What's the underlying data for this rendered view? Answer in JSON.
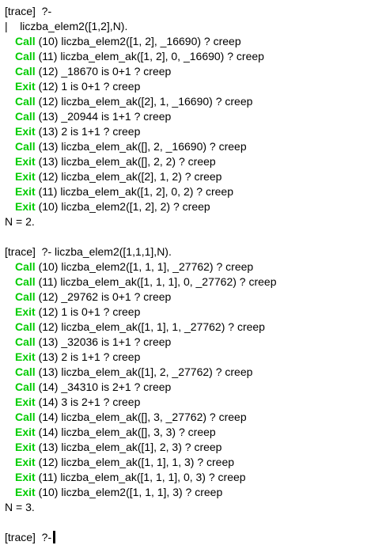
{
  "colors": {
    "background": "#ffffff",
    "text": "#000000",
    "call": "#00cc00",
    "exit": "#00cc00"
  },
  "lines": [
    {
      "type": "prompt",
      "text": "[trace]  ?-"
    },
    {
      "type": "text",
      "text": "|    liczba_elem2([1,2],N)."
    },
    {
      "type": "trace",
      "port": "Call",
      "text": " (10) liczba_elem2([1, 2], _16690) ? creep"
    },
    {
      "type": "trace",
      "port": "Call",
      "text": " (11) liczba_elem_ak([1, 2], 0, _16690) ? creep"
    },
    {
      "type": "trace",
      "port": "Call",
      "text": " (12) _18670 is 0+1 ? creep"
    },
    {
      "type": "trace",
      "port": "Exit",
      "text": " (12) 1 is 0+1 ? creep"
    },
    {
      "type": "trace",
      "port": "Call",
      "text": " (12) liczba_elem_ak([2], 1, _16690) ? creep"
    },
    {
      "type": "trace",
      "port": "Call",
      "text": " (13) _20944 is 1+1 ? creep"
    },
    {
      "type": "trace",
      "port": "Exit",
      "text": " (13) 2 is 1+1 ? creep"
    },
    {
      "type": "trace",
      "port": "Call",
      "text": " (13) liczba_elem_ak([], 2, _16690) ? creep"
    },
    {
      "type": "trace",
      "port": "Exit",
      "text": " (13) liczba_elem_ak([], 2, 2) ? creep"
    },
    {
      "type": "trace",
      "port": "Exit",
      "text": " (12) liczba_elem_ak([2], 1, 2) ? creep"
    },
    {
      "type": "trace",
      "port": "Exit",
      "text": " (11) liczba_elem_ak([1, 2], 0, 2) ? creep"
    },
    {
      "type": "trace",
      "port": "Exit",
      "text": " (10) liczba_elem2([1, 2], 2) ? creep"
    },
    {
      "type": "text",
      "text": "N = 2."
    },
    {
      "type": "blank",
      "text": ""
    },
    {
      "type": "prompt",
      "text": "[trace]  ?- liczba_elem2([1,1,1],N)."
    },
    {
      "type": "trace",
      "port": "Call",
      "text": " (10) liczba_elem2([1, 1, 1], _27762) ? creep"
    },
    {
      "type": "trace",
      "port": "Call",
      "text": " (11) liczba_elem_ak([1, 1, 1], 0, _27762) ? creep"
    },
    {
      "type": "trace",
      "port": "Call",
      "text": " (12) _29762 is 0+1 ? creep"
    },
    {
      "type": "trace",
      "port": "Exit",
      "text": " (12) 1 is 0+1 ? creep"
    },
    {
      "type": "trace",
      "port": "Call",
      "text": " (12) liczba_elem_ak([1, 1], 1, _27762) ? creep"
    },
    {
      "type": "trace",
      "port": "Call",
      "text": " (13) _32036 is 1+1 ? creep"
    },
    {
      "type": "trace",
      "port": "Exit",
      "text": " (13) 2 is 1+1 ? creep"
    },
    {
      "type": "trace",
      "port": "Call",
      "text": " (13) liczba_elem_ak([1], 2, _27762) ? creep"
    },
    {
      "type": "trace",
      "port": "Call",
      "text": " (14) _34310 is 2+1 ? creep"
    },
    {
      "type": "trace",
      "port": "Exit",
      "text": " (14) 3 is 2+1 ? creep"
    },
    {
      "type": "trace",
      "port": "Call",
      "text": " (14) liczba_elem_ak([], 3, _27762) ? creep"
    },
    {
      "type": "trace",
      "port": "Exit",
      "text": " (14) liczba_elem_ak([], 3, 3) ? creep"
    },
    {
      "type": "trace",
      "port": "Exit",
      "text": " (13) liczba_elem_ak([1], 2, 3) ? creep"
    },
    {
      "type": "trace",
      "port": "Exit",
      "text": " (12) liczba_elem_ak([1, 1], 1, 3) ? creep"
    },
    {
      "type": "trace",
      "port": "Exit",
      "text": " (11) liczba_elem_ak([1, 1, 1], 0, 3) ? creep"
    },
    {
      "type": "trace",
      "port": "Exit",
      "text": " (10) liczba_elem2([1, 1, 1], 3) ? creep"
    },
    {
      "type": "text",
      "text": "N = 3."
    },
    {
      "type": "blank",
      "text": ""
    },
    {
      "type": "input",
      "text": "[trace]  ?-"
    }
  ]
}
